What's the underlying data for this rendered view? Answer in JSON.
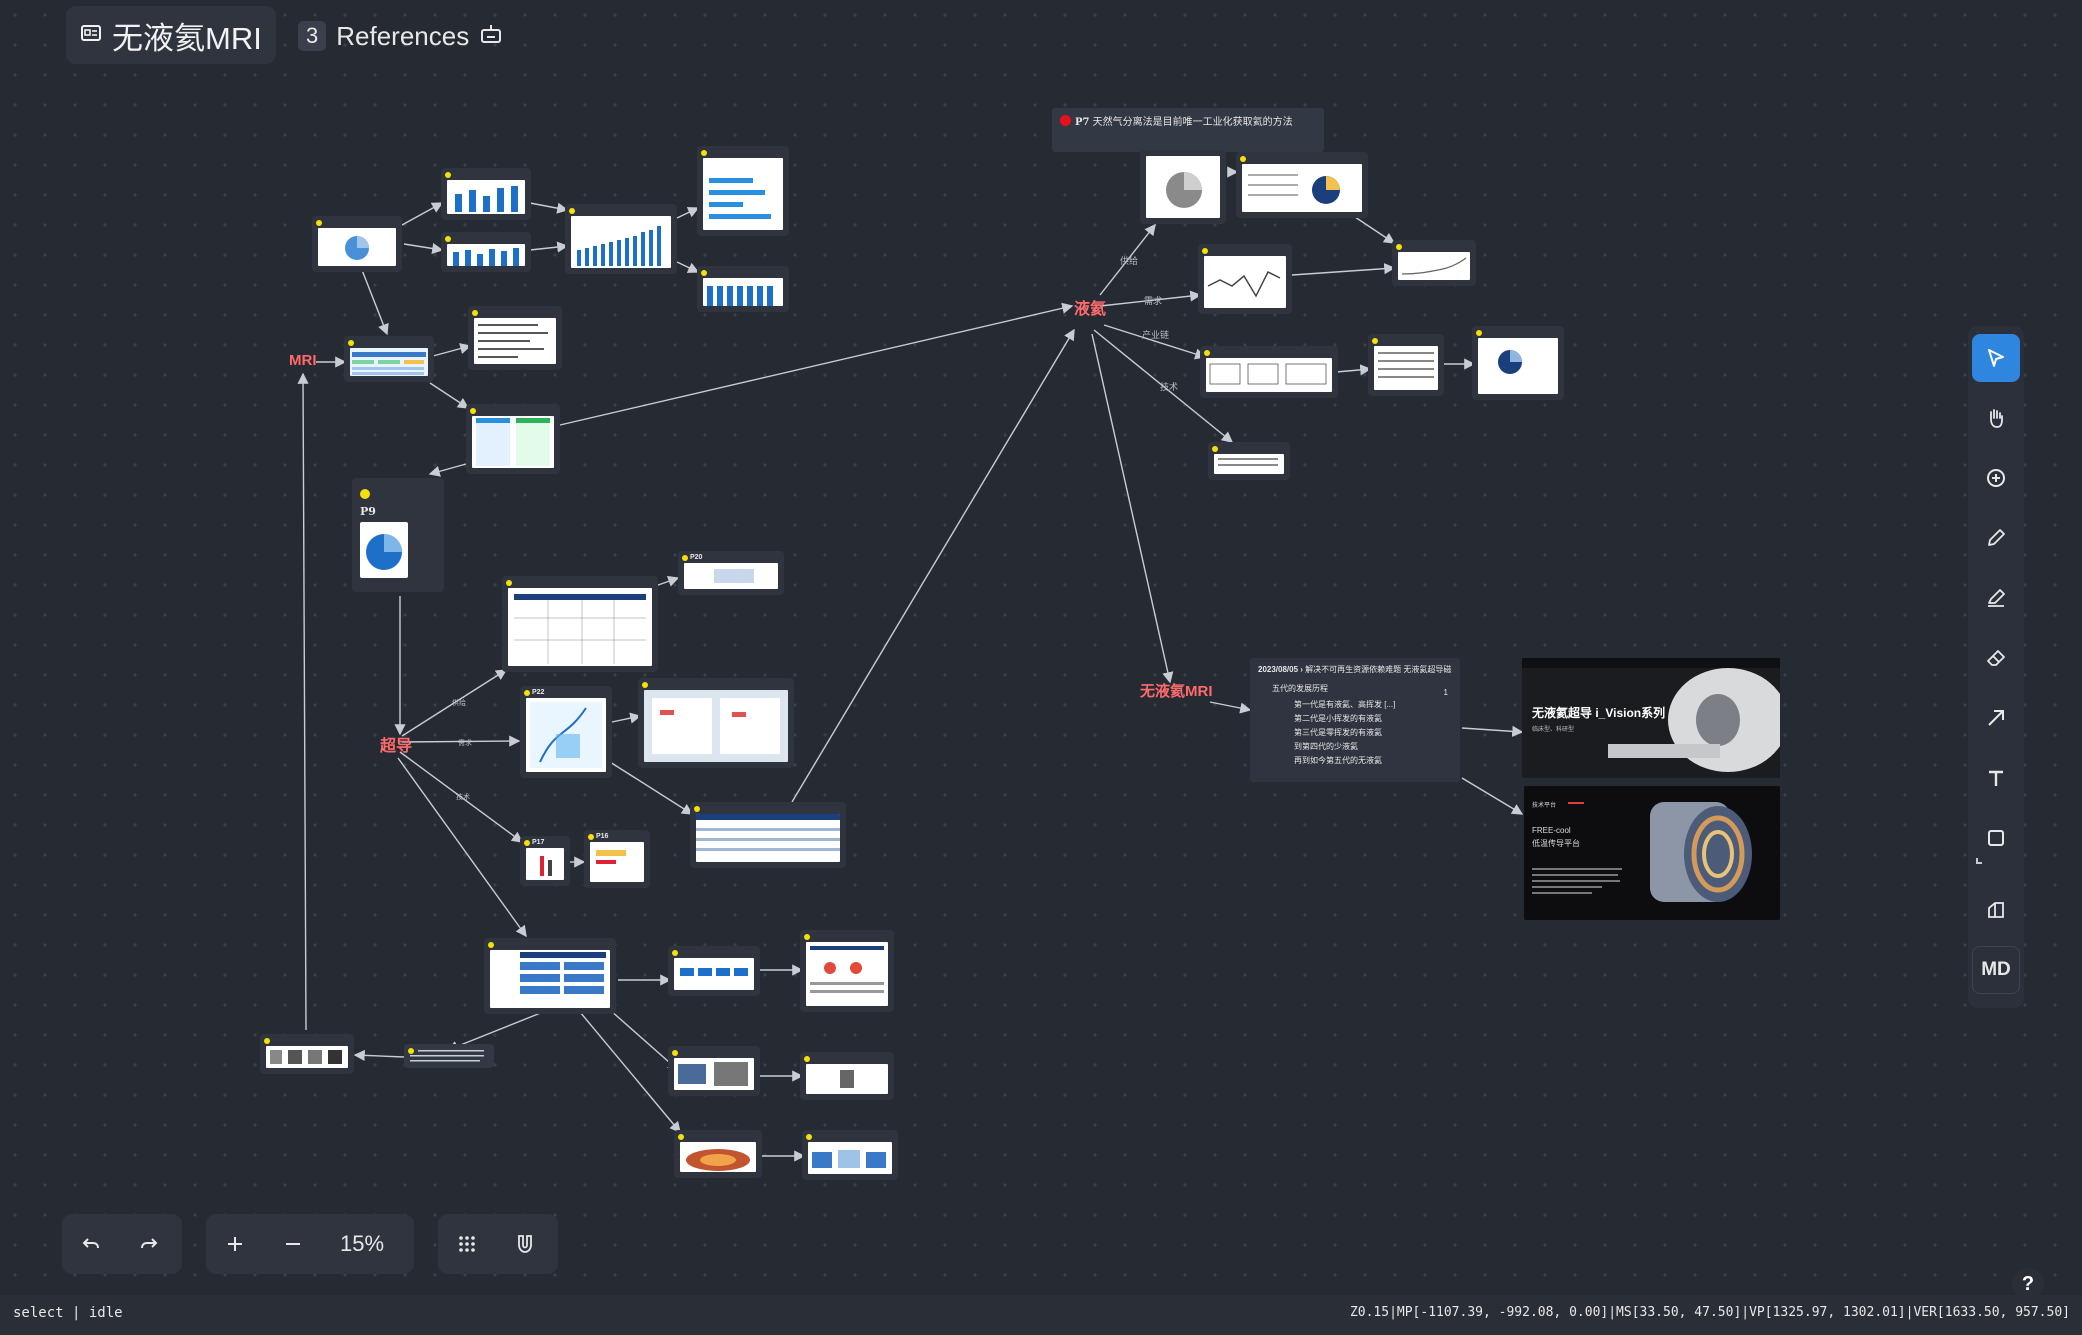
{
  "header": {
    "title": "无液氦MRI",
    "references_count": "3",
    "references_label": "References"
  },
  "nodes": {
    "mri": "MRI",
    "liquid_helium": "液氦",
    "helium_free_mri": "无液氦MRI",
    "superconductor": "超导"
  },
  "edge_labels": {
    "supply": "供给",
    "demand": "需求",
    "industry_chain": "产业链",
    "tech": "技术",
    "ec1": "供给",
    "ec2": "需求",
    "ec3": "技术"
  },
  "notes": {
    "p7_label": "P7",
    "p7_text": "天然气分离法是目前唯一工业化获取氦的方法",
    "p9_label": "P9"
  },
  "card_tags": {
    "p20": "P20",
    "p22": "P22",
    "p16": "P16",
    "p17": "P17"
  },
  "timeline": {
    "date": "2023/08/05",
    "headline": "解决不可再生资源依赖难题 无液氦超导磁共振",
    "section": "五代的发展历程",
    "items": [
      "第一代是有液氦、高挥发 [...]",
      "第二代是小挥发的有液氦",
      "第三代是零挥发的有液氦",
      "到第四代的少液氦",
      "再到如今第五代的无液氦"
    ],
    "count": "1"
  },
  "promo": {
    "top_title": "无液氦超导 i_Vision系列",
    "top_sub": "临床型、科研型",
    "bottom_badge": "技术平台",
    "bottom_title_1": "FREE-cool",
    "bottom_title_2": "低温传导平台"
  },
  "toolbar": {
    "md_label": "MD",
    "tools": [
      "select-tool",
      "hand-tool",
      "add-node-tool",
      "pen-tool",
      "highlighter-tool",
      "eraser-tool",
      "arrow-tool",
      "text-tool",
      "shape-tool",
      "frame-tool"
    ]
  },
  "controls": {
    "zoom_level": "15%"
  },
  "status": {
    "mode": "select | idle",
    "debug": "Z0.15|MP[-1107.39, -992.08, 0.00]|MS[33.50, 47.50]|VP[1325.97, 1302.01]|VER[1633.50, 957.50]"
  },
  "help": "?",
  "colors": {
    "background": "#262a33",
    "accent": "#2e86de",
    "node_red": "#ff6b6b",
    "marker_yellow": "#f5e00a"
  }
}
